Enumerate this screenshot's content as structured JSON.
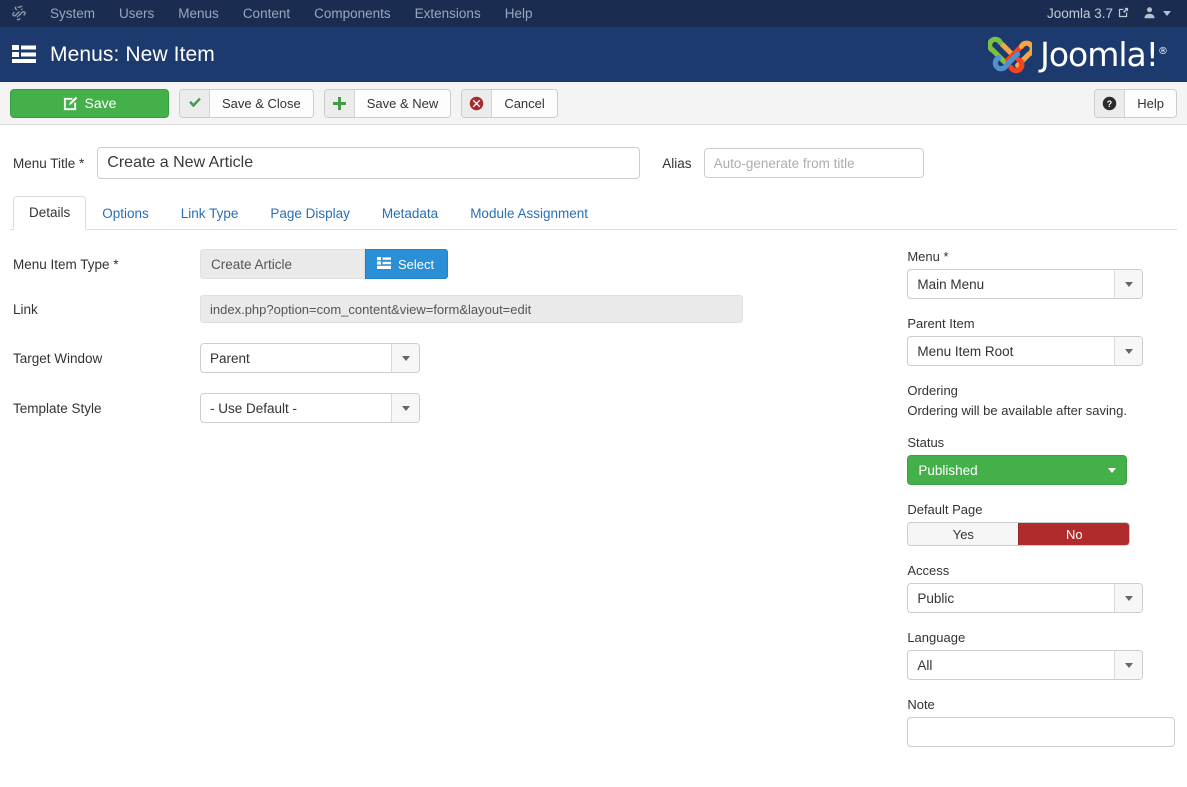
{
  "topnav": {
    "brand_icon": "joomla-mark-icon",
    "items": [
      "System",
      "Users",
      "Menus",
      "Content",
      "Components",
      "Extensions",
      "Help"
    ],
    "version": "Joomla 3.7",
    "version_icon": "external-link-icon",
    "user_icon": "user-icon"
  },
  "subhead": {
    "icon": "list-view-icon",
    "title": "Menus: New Item",
    "logo_text": "Joomla!",
    "logo_trademark": "®"
  },
  "toolbar": {
    "save": {
      "label": "Save",
      "icon": "pencil-square-icon"
    },
    "save_close": {
      "label": "Save & Close",
      "icon": "check-icon"
    },
    "save_new": {
      "label": "Save & New",
      "icon": "plus-icon"
    },
    "cancel": {
      "label": "Cancel",
      "icon": "cancel-circle-icon"
    },
    "help": {
      "label": "Help",
      "icon": "question-circle-icon"
    }
  },
  "form": {
    "menu_title_label": "Menu Title *",
    "menu_title_value": "Create a New Article",
    "menu_title_placeholder": "",
    "alias_label": "Alias",
    "alias_value": "",
    "alias_placeholder": "Auto-generate from title"
  },
  "tabs": [
    {
      "label": "Details",
      "active": true
    },
    {
      "label": "Options",
      "active": false
    },
    {
      "label": "Link Type",
      "active": false
    },
    {
      "label": "Page Display",
      "active": false
    },
    {
      "label": "Metadata",
      "active": false
    },
    {
      "label": "Module Assignment",
      "active": false
    }
  ],
  "details": {
    "menu_item_type_label": "Menu Item Type *",
    "menu_item_type_value": "Create Article",
    "select_button_label": "Select",
    "select_button_icon": "list-icon",
    "link_label": "Link",
    "link_value": "index.php?option=com_content&view=form&layout=edit",
    "target_window_label": "Target Window",
    "target_window_value": "Parent",
    "template_style_label": "Template Style",
    "template_style_value": "- Use Default -"
  },
  "sidebar": {
    "menu_label": "Menu *",
    "menu_value": "Main Menu",
    "parent_item_label": "Parent Item",
    "parent_item_value": "Menu Item Root",
    "ordering_label": "Ordering",
    "ordering_note": "Ordering will be available after saving.",
    "status_label": "Status",
    "status_value": "Published",
    "status_color": "#44b04a",
    "default_page_label": "Default Page",
    "default_page_yes": "Yes",
    "default_page_no": "No",
    "default_page_selected": "No",
    "default_page_on_color": "#b02b2b",
    "access_label": "Access",
    "access_value": "Public",
    "language_label": "Language",
    "language_value": "All",
    "note_label": "Note",
    "note_value": "",
    "note_placeholder": ""
  }
}
